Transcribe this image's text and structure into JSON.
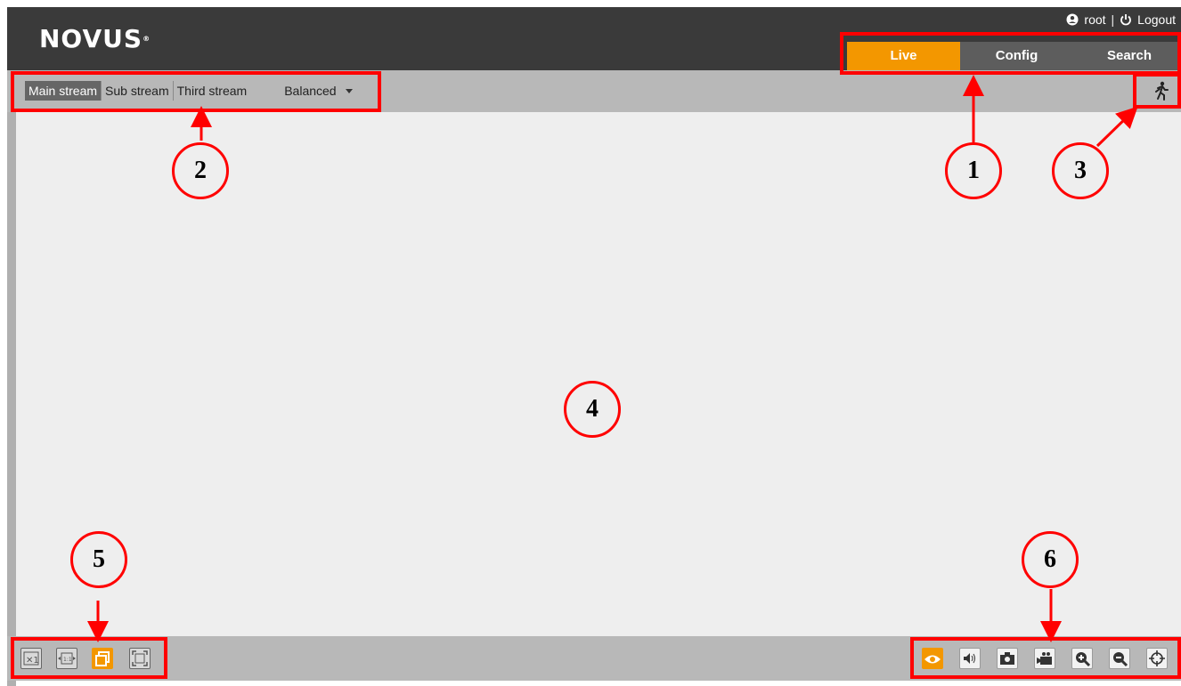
{
  "header": {
    "logo": "NOVUS",
    "user": "root",
    "separator": "|",
    "logout": "Logout",
    "tabs": [
      "Live",
      "Config",
      "Search"
    ]
  },
  "toolbar": {
    "streams": [
      "Main stream",
      "Sub stream",
      "Third stream"
    ],
    "quality": "Balanced"
  },
  "icons": {
    "running_man": "person-running-icon",
    "left_controls": [
      "original-size-icon",
      "fit-icon",
      "window-icon",
      "fullscreen-icon"
    ],
    "right_controls": [
      "live-view-icon",
      "audio-icon",
      "snapshot-icon",
      "record-icon",
      "zoom-in-icon",
      "zoom-out-icon",
      "ptz-icon"
    ]
  },
  "annotations": [
    "1",
    "2",
    "3",
    "4",
    "5",
    "6"
  ],
  "colors": {
    "accent": "#f39700",
    "header": "#3a3a3a",
    "annotation": "#ff0000"
  }
}
